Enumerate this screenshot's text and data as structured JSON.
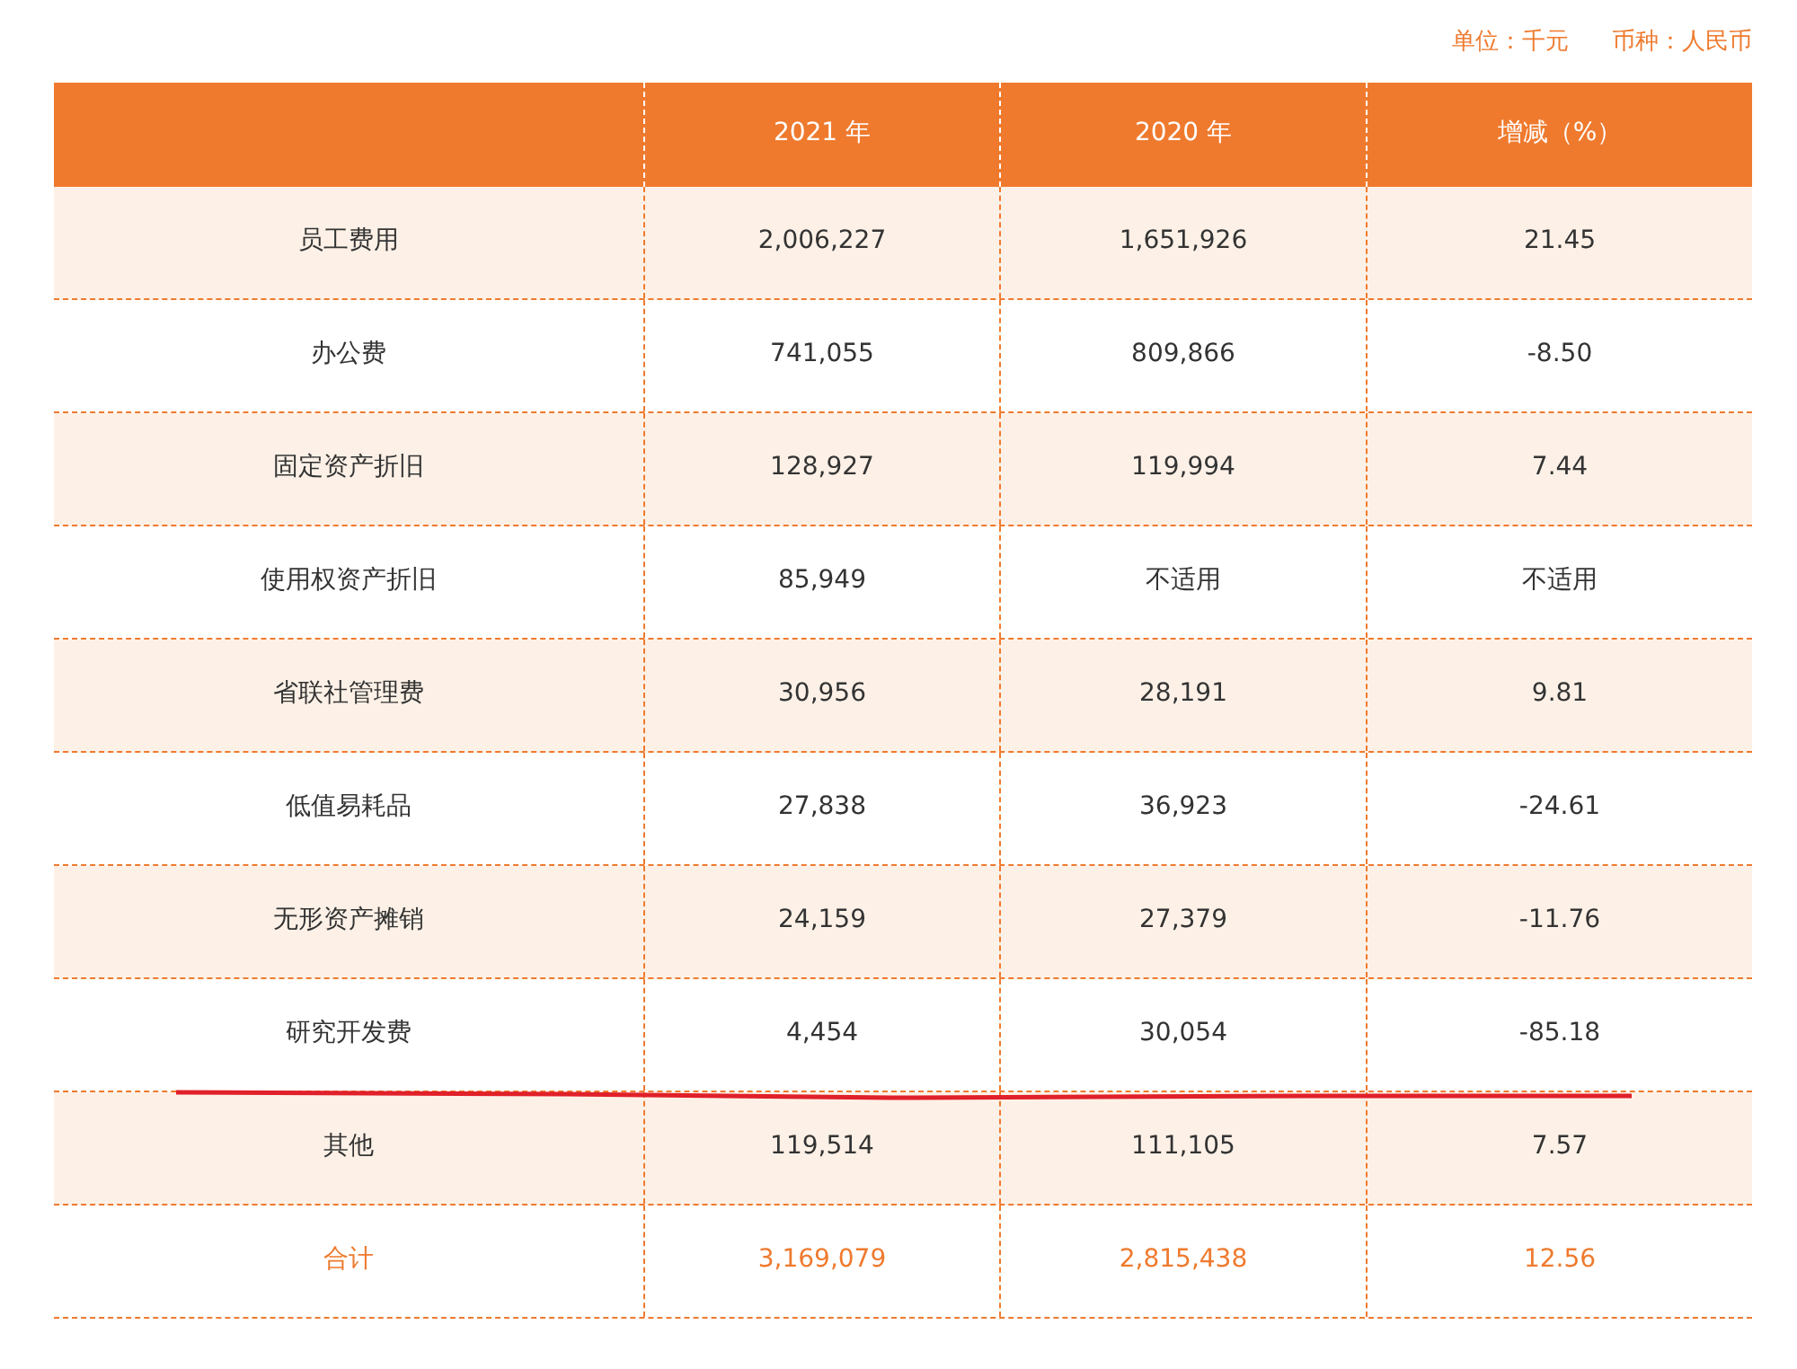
{
  "unit_note": [
    "单位：千元",
    "币种：人民币"
  ],
  "table": {
    "columns": [
      "",
      "2021 年",
      "2020 年",
      "增减（%）"
    ],
    "rows": [
      {
        "kind": "item",
        "cells": [
          "员工费用",
          "2,006,227",
          "1,651,926",
          "21.45"
        ]
      },
      {
        "kind": "item",
        "cells": [
          "办公费",
          "741,055",
          "809,866",
          "-8.50"
        ]
      },
      {
        "kind": "item",
        "cells": [
          "固定资产折旧",
          "128,927",
          "119,994",
          "7.44"
        ]
      },
      {
        "kind": "item",
        "cells": [
          "使用权资产折旧",
          "85,949",
          "不适用",
          "不适用"
        ]
      },
      {
        "kind": "item",
        "cells": [
          "省联社管理费",
          "30,956",
          "28,191",
          "9.81"
        ]
      },
      {
        "kind": "item",
        "cells": [
          "低值易耗品",
          "27,838",
          "36,923",
          "-24.61"
        ]
      },
      {
        "kind": "item",
        "cells": [
          "无形资产摊销",
          "24,159",
          "27,379",
          "-11.76"
        ]
      },
      {
        "kind": "item",
        "cells": [
          "研究开发费",
          "4,454",
          "30,054",
          "-85.18"
        ],
        "underlined": true
      },
      {
        "kind": "item",
        "cells": [
          "其他",
          "119,514",
          "111,105",
          "7.57"
        ]
      },
      {
        "kind": "total",
        "cells": [
          "合计",
          "3,169,079",
          "2,815,438",
          "12.56"
        ]
      }
    ]
  }
}
